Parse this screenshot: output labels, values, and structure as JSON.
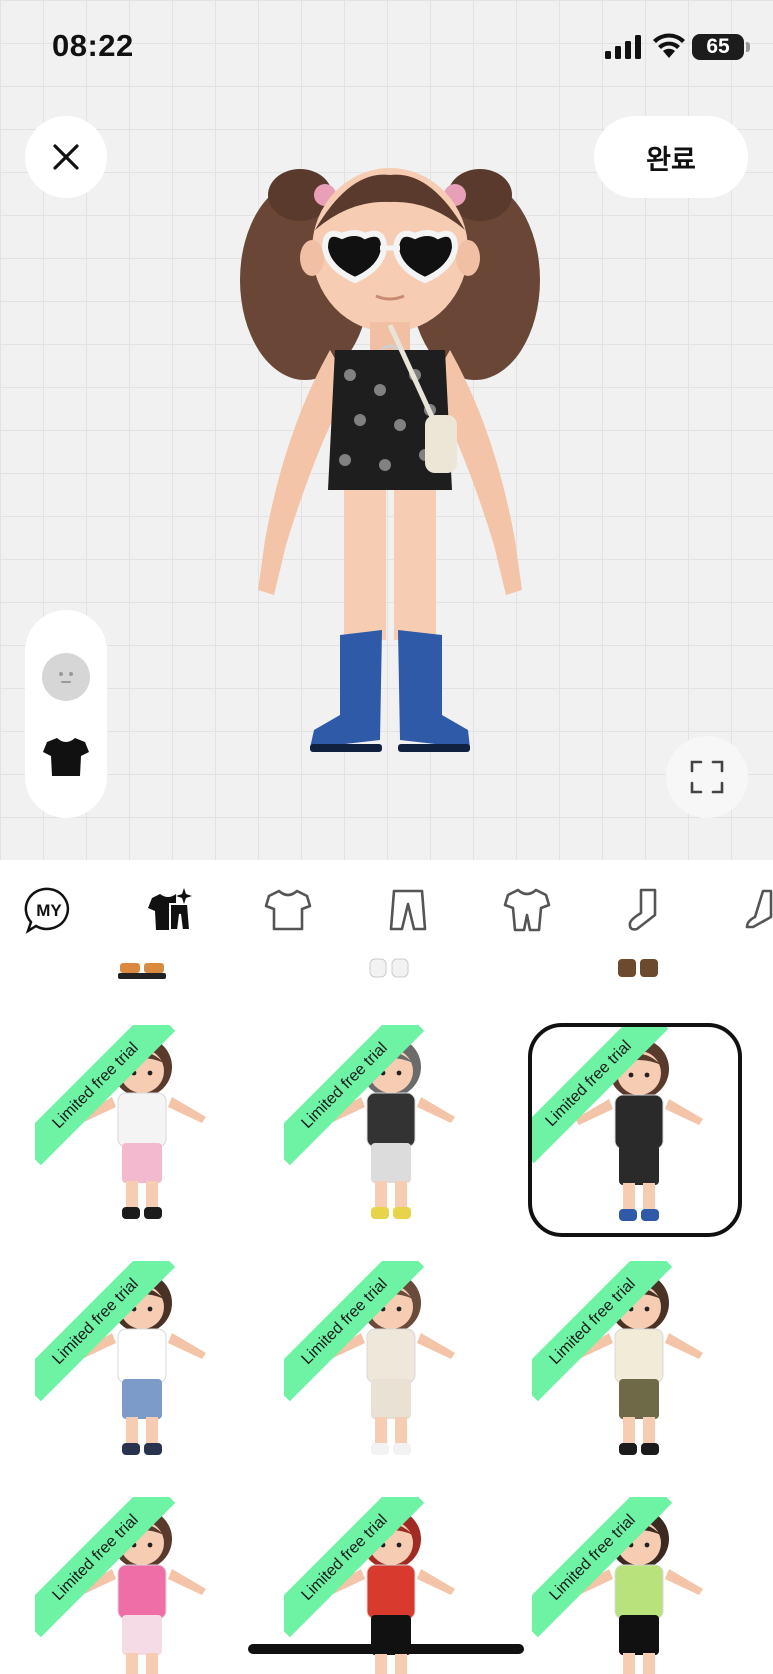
{
  "status": {
    "time": "08:22",
    "battery": "65"
  },
  "header": {
    "done_label": "완료"
  },
  "tabs": [
    {
      "name": "my",
      "label": "MY"
    },
    {
      "name": "outfit-set",
      "icon": "outfit-set-icon"
    },
    {
      "name": "top",
      "icon": "tshirt-icon"
    },
    {
      "name": "bottom",
      "icon": "pants-icon"
    },
    {
      "name": "onepiece",
      "icon": "onepiece-icon"
    },
    {
      "name": "socks",
      "icon": "sock-icon"
    },
    {
      "name": "shoes",
      "icon": "shoe-icon"
    }
  ],
  "outfits": [
    {
      "badge": "Limited free trial",
      "hair": "#5a3a2c",
      "top": "#f4f4f4",
      "bottom": "#f2b9cf",
      "shoes": "#1b1b1b",
      "selected": false
    },
    {
      "badge": "Limited free trial",
      "hair": "#6b6b6b",
      "top": "#333333",
      "bottom": "#dcdcdc",
      "shoes": "#e8d44a",
      "selected": false
    },
    {
      "badge": "Limited free trial",
      "hair": "#5a3a2c",
      "top": "#2a2a2a",
      "bottom": "#2a2a2a",
      "shoes": "#2f5aa8",
      "selected": true
    },
    {
      "badge": "Limited free trial",
      "hair": "#4a3126",
      "top": "#ffffff",
      "bottom": "#7d9bc9",
      "shoes": "#28344e",
      "selected": false
    },
    {
      "badge": "Limited free trial",
      "hair": "#6a4a3a",
      "top": "#efe7da",
      "bottom": "#e8e1d4",
      "shoes": "#f2f2f2",
      "selected": false
    },
    {
      "badge": "Limited free trial",
      "hair": "#4a3126",
      "top": "#f1ecd8",
      "bottom": "#6e6a48",
      "shoes": "#1b1b1b",
      "selected": false
    },
    {
      "badge": "Limited free trial",
      "hair": "#5a3a2c",
      "top": "#f06ea7",
      "bottom": "#f4dbe6",
      "shoes": "#d05a8a",
      "selected": false
    },
    {
      "badge": "Limited free trial",
      "hair": "#a12a22",
      "top": "#d83a2e",
      "bottom": "#111111",
      "shoes": "#c02a24",
      "selected": false
    },
    {
      "badge": "Limited free trial",
      "hair": "#3a2a22",
      "top": "#b8e27c",
      "bottom": "#111111",
      "shoes": "#e6d23c",
      "selected": false
    }
  ]
}
